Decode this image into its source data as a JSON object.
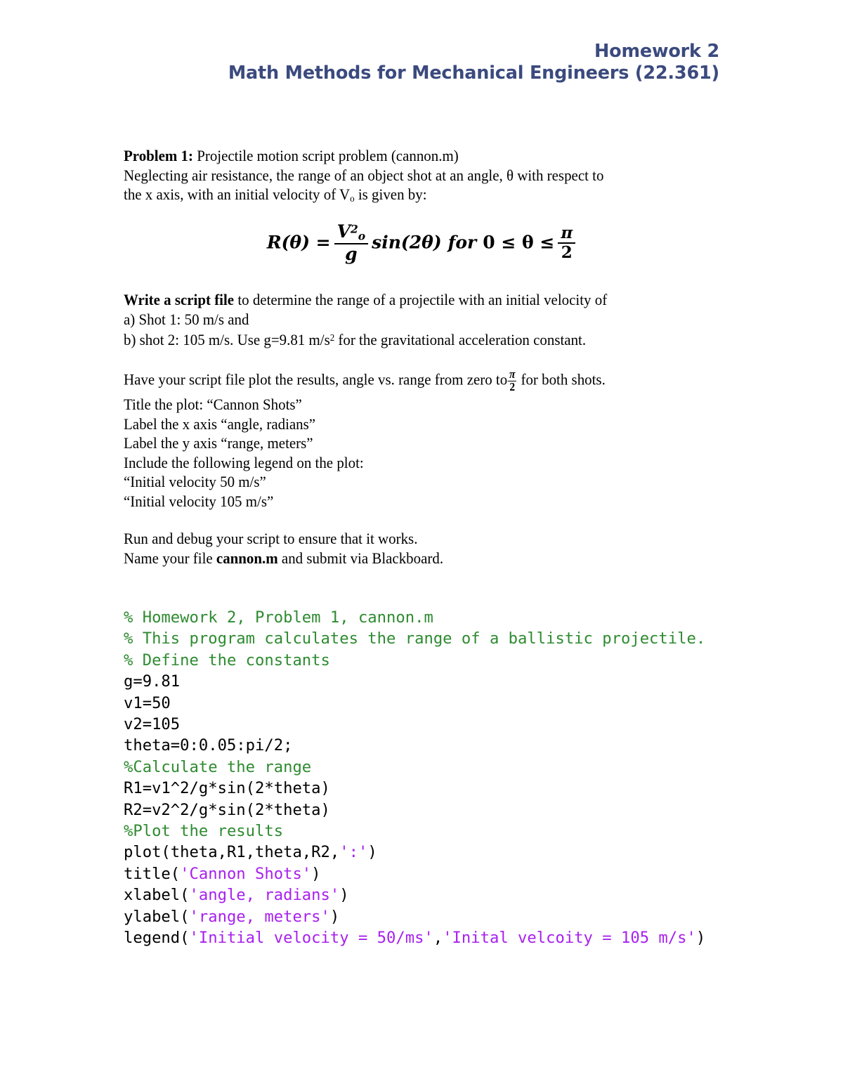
{
  "document": {
    "header": {
      "line1": "Homework 2",
      "line2": "Math Methods for Mechanical Engineers (22.361)",
      "color": "#3b4a7e"
    },
    "problem": {
      "title_bold": "Problem 1:",
      "title_rest": " Projectile motion script problem (cannon.m)",
      "intro_line1": "Neglecting air resistance, the range of an object shot at an angle, θ with respect to",
      "intro_line2_a": "the x axis, with an initial velocity of V",
      "intro_line2_sub": "o",
      "intro_line2_b": " is given by:"
    },
    "equation": {
      "lhs": "R(θ) =",
      "numerator": "V",
      "numerator_sup": "2",
      "numerator_sub": "o",
      "denominator": "g",
      "sin_term": "sin(2θ)",
      "condition_for": "for",
      "condition_range": "0 ≤  θ ≤",
      "frac_num": "π",
      "frac_den": "2",
      "plain_text": "R(θ) = (Vₒ² / g) sin(2θ)  for 0 ≤ θ ≤ π/2"
    },
    "write_block": {
      "line1_bold": "Write a script file",
      "line1_rest": " to determine the range of a projectile with an initial velocity of",
      "line2": "a) Shot 1:  50 m/s and",
      "line3_a": "b) shot 2:  105 m/s.  Use g=9.81 m/s",
      "line3_sup": "2",
      "line3_b": " for the gravitational acceleration constant."
    },
    "plot_request": {
      "line_a": "Have your script file plot the results, angle vs. range from zero to",
      "frac_num": "π",
      "frac_den": "2",
      "line_b": " for both shots."
    },
    "labels_block": {
      "title_line": "Title the plot:  “Cannon Shots”",
      "xaxis_line": "Label the x axis “angle, radians”",
      "yaxis_line": "Label the y axis “range, meters”",
      "legend_intro": "Include the following legend on the plot:",
      "legend_item1": "“Initial velocity 50 m/s”",
      "legend_item2": "“Initial velocity 105 m/s”"
    },
    "run_block": {
      "line1": "Run and debug your script to ensure that it works.",
      "line2_a": "Name your file ",
      "line2_bold": "cannon.m",
      "line2_b": " and submit via Blackboard."
    },
    "code": {
      "language": "matlab",
      "comment_color": "#2e8b30",
      "string_color": "#a820ef",
      "lines": [
        {
          "type": "comment",
          "text": "% Homework 2, Problem 1, cannon.m"
        },
        {
          "type": "comment",
          "text": "% This program calculates the range of a ballistic projectile."
        },
        {
          "type": "comment",
          "text": "% Define the constants"
        },
        {
          "type": "code",
          "text": "g=9.81"
        },
        {
          "type": "code",
          "text": "v1=50"
        },
        {
          "type": "code",
          "text": "v2=105"
        },
        {
          "type": "code",
          "text": "theta=0:0.05:pi/2;"
        },
        {
          "type": "comment",
          "text": "%Calculate the range"
        },
        {
          "type": "code",
          "text": "R1=v1^2/g*sin(2*theta)"
        },
        {
          "type": "code",
          "text": "R2=v2^2/g*sin(2*theta)"
        },
        {
          "type": "comment",
          "text": "%Plot the results"
        },
        {
          "type": "mixed",
          "pre": "plot(theta,R1,theta,R2,",
          "str": "':'",
          "post": ")"
        },
        {
          "type": "mixed",
          "pre": "title(",
          "str": "'Cannon Shots'",
          "post": ")"
        },
        {
          "type": "mixed",
          "pre": "xlabel(",
          "str": "'angle, radians'",
          "post": ")"
        },
        {
          "type": "mixed",
          "pre": "ylabel(",
          "str": "'range, meters'",
          "post": ")"
        },
        {
          "type": "legend",
          "pre": "legend(",
          "str1": "'Initial velocity = 50/ms'",
          "mid": ",",
          "str2": "'Inital velcoity = 105 m/s'",
          "post": ")"
        }
      ]
    }
  }
}
